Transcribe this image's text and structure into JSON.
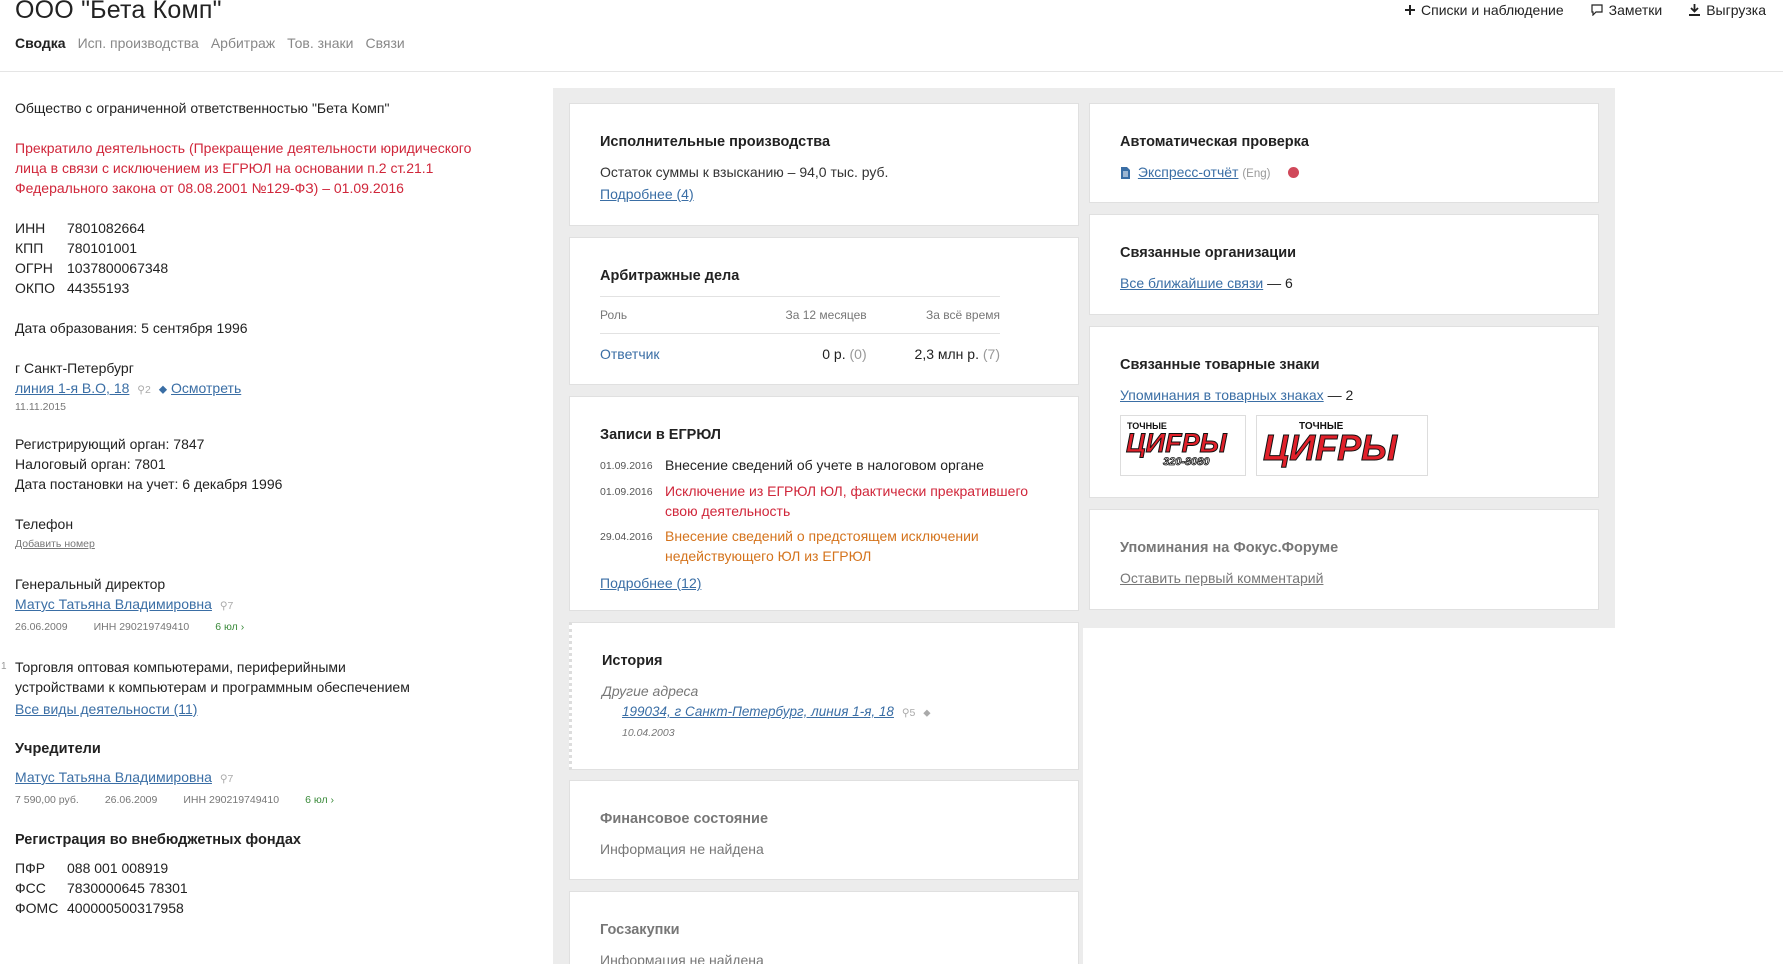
{
  "header": {
    "company_title": "ООО \"Бета Комп\"",
    "tabs": [
      "Сводка",
      "Исп. производства",
      "Арбитраж",
      "Тов. знаки",
      "Связи"
    ],
    "actions": {
      "lists": "Списки и наблюдение",
      "notes": "Заметки",
      "export": "Выгрузка"
    }
  },
  "left": {
    "full_name": "Общество с ограниченной ответственностью \"Бета Комп\"",
    "status": "Прекратило деятельность (Прекращение деятельности юридического лица в связи с исключением из ЕГРЮЛ на основании п.2 ст.21.1 Федерального закона от 08.08.2001 №129-ФЗ) – 01.09.2016",
    "ids": [
      {
        "k": "ИНН",
        "v": "7801082664"
      },
      {
        "k": "КПП",
        "v": "780101001"
      },
      {
        "k": "ОГРН",
        "v": "1037800067348"
      },
      {
        "k": "ОКПО",
        "v": "44355193"
      }
    ],
    "founded": "Дата образования: 5 сентября 1996",
    "city": "г Санкт-Петербург",
    "address_link": "линия 1-я В.О, 18",
    "address_count": "2",
    "view_link": "Осмотреть",
    "address_date": "11.11.2015",
    "reg_org": "Регистрирующий орган: 7847",
    "tax_org": "Налоговый орган: 7801",
    "tax_date": "Дата постановки на учет: 6 декабря 1996",
    "phone_label": "Телефон",
    "add_phone": "Добавить номер",
    "director_role": "Генеральный директор",
    "director_name": "Матус Татьяна Владимировна",
    "director_count": "7",
    "director_date": "26.06.2009",
    "director_inn": "ИНН 290219749410",
    "director_links": "6 юл",
    "okved_num": "1",
    "okved_text": "Торговля оптовая компьютерами, периферийными устройствами к компьютерам и программным обеспечением",
    "all_activities": "Все виды деятельности (11)",
    "founders_h": "Учредители",
    "founder_name": "Матус Татьяна Владимировна",
    "founder_count": "7",
    "founder_share": "7 590,00 руб.",
    "founder_date": "26.06.2009",
    "founder_inn": "ИНН 290219749410",
    "founder_links": "6 юл",
    "funds_h": "Регистрация во внебюджетных фондах",
    "funds": [
      {
        "k": "ПФР",
        "v": "088 001 008919"
      },
      {
        "k": "ФСС",
        "v": "7830000645 78301"
      },
      {
        "k": "ФОМС",
        "v": "400000500317958"
      }
    ]
  },
  "cards": {
    "enforcement": {
      "title": "Исполнительные производства",
      "text": "Остаток суммы к взысканию – 94,0 тыс. руб.",
      "more": "Подробнее (4)"
    },
    "arbitration": {
      "title": "Арбитражные дела",
      "headers": [
        "Роль",
        "За 12 месяцев",
        "За всё время"
      ],
      "role": "Ответчик",
      "y12": "0 р.",
      "y12_count": "(0)",
      "all": "2,3 млн р.",
      "all_count": "(7)"
    },
    "egrul": {
      "title": "Записи в ЕГРЮЛ",
      "rows": [
        {
          "date": "01.09.2016",
          "text": "Внесение сведений об учете в налоговом органе"
        },
        {
          "date": "01.09.2016",
          "text": "Исключение из ЕГРЮЛ ЮЛ, фактически прекратившего свою деятельность"
        },
        {
          "date": "29.04.2016",
          "text": "Внесение сведений о предстоящем исключении недействующего ЮЛ из ЕГРЮЛ"
        }
      ],
      "more": "Подробнее (12)"
    },
    "history": {
      "title": "История",
      "subtitle": "Другие адреса",
      "address": "199034, г Санкт-Петербург, линия 1-я, 18",
      "address_count": "5",
      "date": "10.04.2003"
    },
    "finance": {
      "title": "Финансовое состояние",
      "text": "Информация не найдена"
    },
    "procurement": {
      "title": "Госзакупки",
      "text": "Информация не найдена"
    },
    "auto_check": {
      "title": "Автоматическая проверка",
      "link": "Экспресс-отчёт",
      "lang": "(Eng)"
    },
    "related_orgs": {
      "title": "Связанные организации",
      "link": "Все ближайшие связи",
      "count": "— 6"
    },
    "trademarks": {
      "title": "Связанные товарные знаки",
      "link": "Упоминания в товарных знаках",
      "count": "— 2",
      "logo1_top": "ТОЧНЫЕ",
      "logo1_main": "ЦИFРЫ",
      "logo1_phone": "320-8080",
      "logo2_top": "ТОЧНЫЕ",
      "logo2_main": "ЦИFРЫ"
    },
    "forum": {
      "title": "Упоминания на Фокус.Форуме",
      "link": "Оставить первый комментарий"
    }
  },
  "colors": {
    "link": "#3a6ea5",
    "danger": "#d0263a",
    "warning": "#d4731c",
    "panel_bg": "#ececec"
  }
}
